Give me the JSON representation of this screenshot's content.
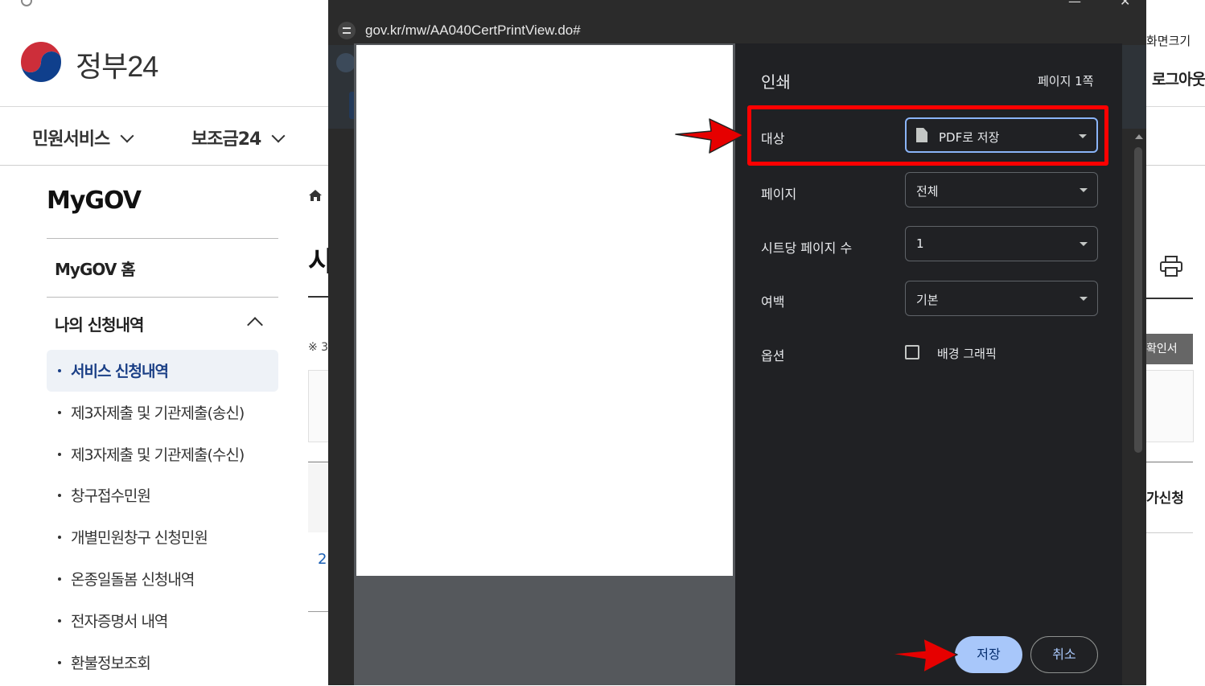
{
  "browser_tab": {
    "title": ""
  },
  "site": {
    "logo_text": "정부24",
    "gnb": [
      {
        "label": "민원서비스"
      },
      {
        "label": "보조금24"
      }
    ],
    "sidebar": {
      "title": "MyGOV",
      "home": "MyGOV 홈",
      "group": "나의 신청내역",
      "items": [
        {
          "label": "서비스 신청내역",
          "active": true
        },
        {
          "label": "제3자제출 및 기관제출(송신)"
        },
        {
          "label": "제3자제출 및 기관제출(수신)"
        },
        {
          "label": "창구접수민원"
        },
        {
          "label": "개별민원창구 신청민원"
        },
        {
          "label": "온종일돌봄 신청내역"
        },
        {
          "label": "전자증명서 내역"
        },
        {
          "label": "환불정보조회"
        }
      ]
    },
    "main": {
      "heading_fragment": "시",
      "note_fragment": "※ 3",
      "year_fragment": "2("
    },
    "right": {
      "zoom": "화면크기",
      "logout": "로그아웃",
      "badge": "확인서",
      "apply": "가신청"
    }
  },
  "popup": {
    "url": "gov.kr/mw/AA040CertPrintView.do#",
    "controls": {
      "minimize": "—",
      "close": "✕"
    }
  },
  "print_dialog": {
    "title": "인쇄",
    "page_count": "페이지 1쪽",
    "fields": [
      {
        "label": "대상",
        "value": "PDF로 저장"
      },
      {
        "label": "페이지",
        "value": "전체"
      },
      {
        "label": "시트당 페이지 수",
        "value": "1"
      },
      {
        "label": "여백",
        "value": "기본"
      }
    ],
    "options": {
      "label": "옵션",
      "checkbox_label": "배경 그래픽",
      "checked": false
    },
    "save_label": "저장",
    "cancel_label": "취소"
  },
  "colors": {
    "annotation": "#ff0000",
    "dialog_bg": "#202124",
    "save_button": "#a8c7fa",
    "active_menu": "#1a3f86"
  }
}
